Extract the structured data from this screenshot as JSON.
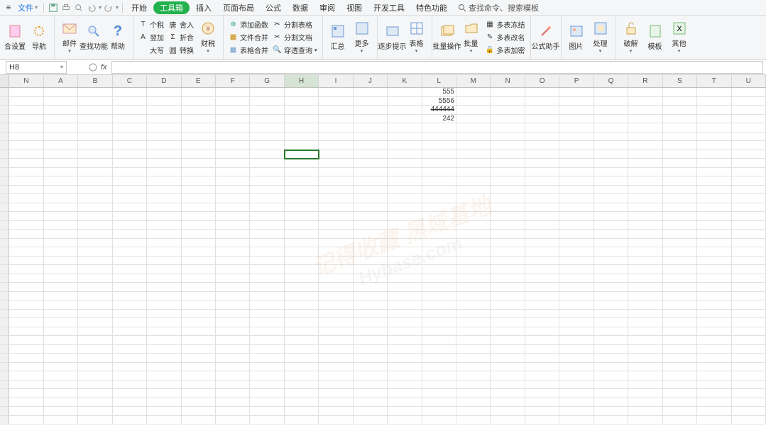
{
  "topbar": {
    "menu_icon": "≡",
    "file_label": "文件",
    "tabs": [
      "开始",
      "工具箱",
      "插入",
      "页面布局",
      "公式",
      "数据",
      "审阅",
      "视图",
      "开发工具",
      "特色功能"
    ],
    "search_label": "查找命令、搜索模板"
  },
  "ribbon": {
    "g1": [
      {
        "label": "合设置",
        "icon": "page"
      },
      {
        "label": "导航",
        "icon": "compass"
      }
    ],
    "g2": [
      {
        "label": "邮件",
        "icon": "mail"
      },
      {
        "label": "查找功能",
        "icon": "search"
      },
      {
        "label": "帮助",
        "icon": "help"
      }
    ],
    "g3_rows": [
      [
        {
          "i": "T",
          "l": "个税"
        },
        {
          "i": "唐",
          "l": "舍入"
        }
      ],
      [
        {
          "i": "A",
          "l": "翌加"
        },
        {
          "i": "Σ",
          "l": "折合"
        }
      ],
      [
        {
          "i": "",
          "l": "大写"
        },
        {
          "i": "圆",
          "l": "转换"
        }
      ]
    ],
    "g3b": {
      "label": "财税"
    },
    "g4_rows": [
      {
        "i": "+",
        "l": "添加函数"
      },
      {
        "i": "□",
        "l": "文件合并"
      },
      {
        "i": "□",
        "l": "表格合并"
      }
    ],
    "g5_rows": [
      {
        "i": "✂",
        "l": "分割表格"
      },
      {
        "i": "✂",
        "l": "分割文档"
      },
      {
        "i": "🔍",
        "l": "穿透查询"
      }
    ],
    "g6": [
      {
        "label": "汇总"
      },
      {
        "label": "更多"
      }
    ],
    "g7": [
      {
        "label": "逐步提示"
      },
      {
        "label": "表格"
      }
    ],
    "g8": [
      {
        "label": "批量操作"
      },
      {
        "label": "批量"
      }
    ],
    "g8_rows": [
      {
        "i": "🔒",
        "l": "多表冻结"
      },
      {
        "i": "✎",
        "l": "多表改名"
      },
      {
        "i": "🔐",
        "l": "多表加密"
      }
    ],
    "g9": [
      {
        "label": "公式助手"
      }
    ],
    "g10": [
      {
        "label": "图片"
      },
      {
        "label": "处理"
      }
    ],
    "g11": [
      {
        "label": "破解"
      },
      {
        "label": "模板"
      },
      {
        "label": "其他"
      }
    ]
  },
  "formula_bar": {
    "name_box": "H8",
    "fx": "fx",
    "value": ""
  },
  "grid": {
    "cols": [
      "N",
      "A",
      "B",
      "C",
      "D",
      "E",
      "F",
      "G",
      "H",
      "I",
      "J",
      "K",
      "L",
      "M",
      "N",
      "O",
      "P",
      "Q",
      "R",
      "S",
      "T",
      "U"
    ],
    "selected_col_index": 8,
    "selected_row": 8,
    "data": {
      "L1": "555",
      "L2": "5556",
      "L3": "444444",
      "L4": "242"
    },
    "strike": [
      "L3"
    ]
  },
  "watermark": {
    "l1": "记得收藏 黑域基地",
    "l2": "Hybase.com"
  }
}
